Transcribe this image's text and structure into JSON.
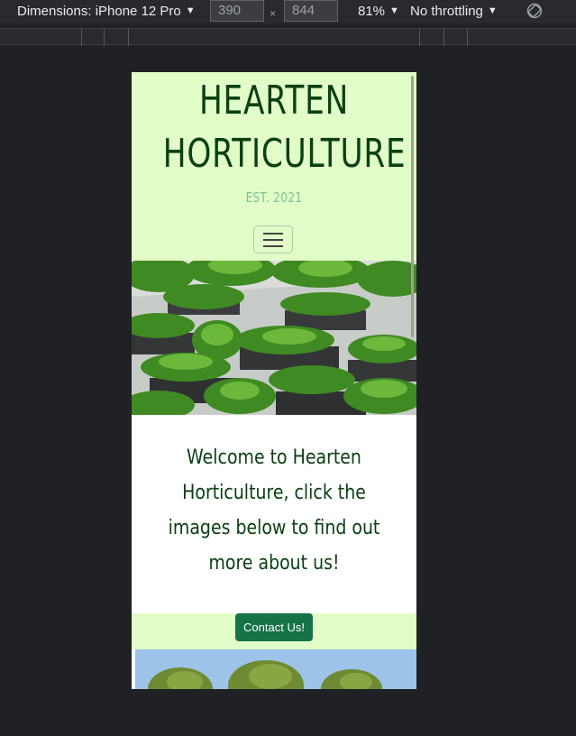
{
  "devtools": {
    "device_label": "Dimensions: iPhone 12 Pro",
    "width_value": "390",
    "height_value": "844",
    "times": "×",
    "zoom": "81%",
    "throttle": "No throttling",
    "arrow": "▼"
  },
  "site": {
    "title_line1": "HEARTEN",
    "title_line2": "HORTICULTURE",
    "est": "EST. 2021",
    "welcome": "Welcome to Hearten Horticulture, click the images below to find out more about us!",
    "contact_label": "Contact Us!"
  },
  "colors": {
    "header_bg": "#e2fcc8",
    "title": "#0a4012",
    "est": "#7ec28f",
    "button": "#157347"
  }
}
